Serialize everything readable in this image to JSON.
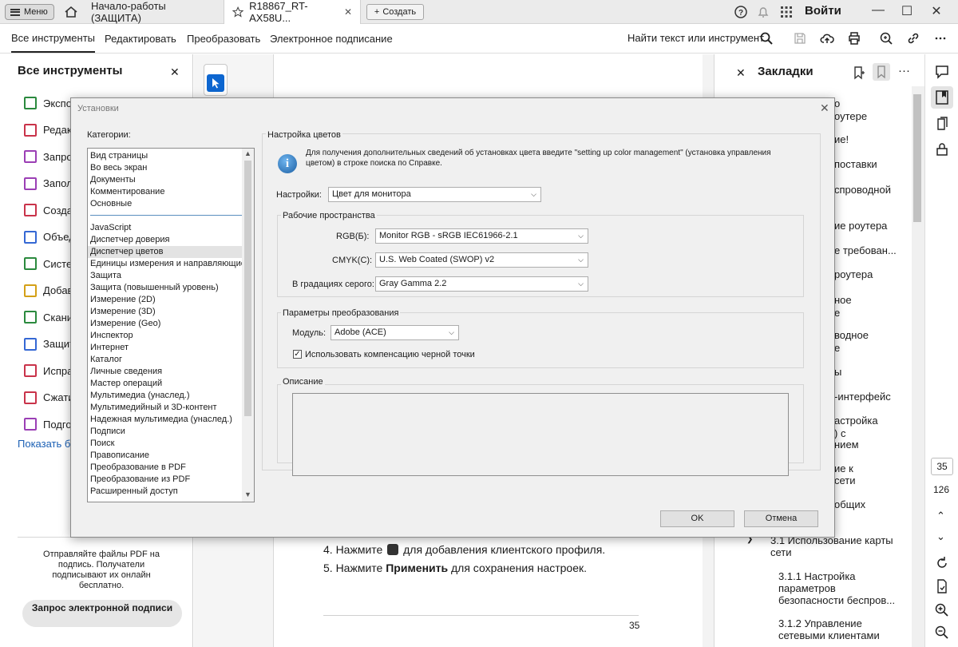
{
  "topbar": {
    "menu_label": "Меню",
    "tabs": [
      {
        "label": "Начало-работы (ЗАЩИТА)"
      },
      {
        "label": "R18867_RT-AX58U..."
      }
    ],
    "new_label": "Создать",
    "login_label": "Войти"
  },
  "toolbar": {
    "tabs": [
      "Все инструменты",
      "Редактировать",
      "Преобразовать",
      "Электронное подписание"
    ],
    "find_label": "Найти текст или инструмент"
  },
  "left_panel": {
    "title": "Все инструменты",
    "items": [
      {
        "label": "Экспо",
        "color": "#2b8a3e"
      },
      {
        "label": "Редак",
        "color": "#c9334a"
      },
      {
        "label": "Запро",
        "color": "#9b3fb5"
      },
      {
        "label": "Запол",
        "color": "#9b3fb5"
      },
      {
        "label": "Созда",
        "color": "#c9334a"
      },
      {
        "label": "Объед",
        "color": "#3568d4"
      },
      {
        "label": "Систе",
        "color": "#2b8a3e"
      },
      {
        "label": "Добав",
        "color": "#d4a017"
      },
      {
        "label": "Скани",
        "color": "#2b8a3e"
      },
      {
        "label": "Защит",
        "color": "#3568d4"
      },
      {
        "label": "Испра",
        "color": "#c9334a"
      },
      {
        "label": "Сжати",
        "color": "#c9334a"
      },
      {
        "label": "Подго",
        "color": "#9b3fb5"
      }
    ],
    "show_more": "Показать бо",
    "promo_text": "Отправляйте файлы PDF на подпись. Получатели подписывают их онлайн бесплатно.",
    "request_button": "Запрос электронной подписи"
  },
  "document": {
    "step4_prefix": "4.  Нажмите",
    "step4_suffix": "для добавления клиентского профиля.",
    "step5_prefix": "5.  Нажмите",
    "step5_bold": "Применить",
    "step5_suffix": "для сохранения настроек.",
    "page_number": "35"
  },
  "bookmarks": {
    "title": "Закладки",
    "items": [
      "о",
      "оутере",
      "ие!",
      "поставки",
      "спроводной",
      "ие роутера",
      "е требован...",
      "роутера",
      "ное",
      "е",
      "водное",
      "е",
      "ы",
      "-интерфейс",
      "астройка",
      ") с",
      "нием",
      "ие к",
      "сети",
      "общих",
      "3.1 Использование карты",
      "сети",
      "3.1.1 Настройка",
      "параметров",
      "безопасности беспров...",
      "3.1.2 Управление",
      "сетевыми клиентами"
    ]
  },
  "far_rail": {
    "current_page": "35",
    "total_pages": "126"
  },
  "dialog": {
    "title": "Установки",
    "categories_label": "Категории:",
    "categories_group1": [
      "Вид страницы",
      "Во весь экран",
      "Документы",
      "Комментирование",
      "Основные"
    ],
    "categories_group2": [
      "JavaScript",
      "Диспетчер доверия",
      "Диспетчер цветов",
      "Единицы измерения и направляющие",
      "Защита",
      "Защита (повышенный уровень)",
      "Измерение (2D)",
      "Измерение (3D)",
      "Измерение (Geo)",
      "Инспектор",
      "Интернет",
      "Каталог",
      "Личные сведения",
      "Мастер операций",
      "Мультимедиа (унаслед.)",
      "Мультимедийный и 3D-контент",
      "Надежная мультимедиа (унаслед.)",
      "Подписи",
      "Поиск",
      "Правописание",
      "Преобразование в PDF",
      "Преобразование из PDF",
      "Расширенный доступ"
    ],
    "selected_category": "Диспетчер цветов",
    "section_title": "Настройка цветов",
    "info_text": "Для получения дополнительных сведений об установках цвета введите \"setting up color management\" (установка управления цветом) в строке поиска по Справке.",
    "settings_label": "Настройки:",
    "settings_value": "Цвет для монитора",
    "workspaces_title": "Рабочие пространства",
    "rgb_label": "RGB(Б):",
    "rgb_value": "Monitor RGB - sRGB IEC61966-2.1",
    "cmyk_label": "CMYK(С):",
    "cmyk_value": "U.S. Web Coated (SWOP) v2",
    "gray_label": "В градациях серого:",
    "gray_value": "Gray Gamma 2.2",
    "conversion_title": "Параметры преобразования",
    "module_label": "Модуль:",
    "module_value": "Adobe (ACE)",
    "blackpoint_label": "Использовать компенсацию черной точки",
    "blackpoint_checked": true,
    "description_title": "Описание",
    "ok_label": "OK",
    "cancel_label": "Отмена"
  },
  "colors": {
    "accent": "#0d66d0",
    "link": "#1a5fb4"
  }
}
